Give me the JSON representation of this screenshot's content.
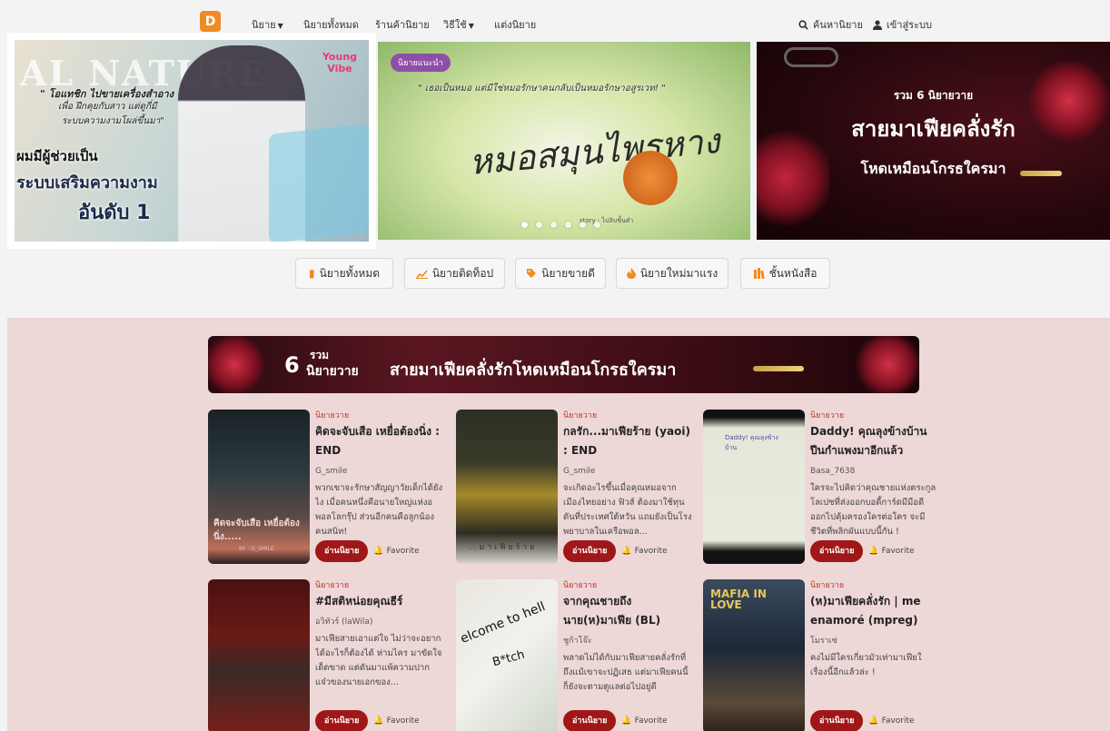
{
  "nav": {
    "logo": "D",
    "items": [
      {
        "label": "นิยาย",
        "dropdown": true
      },
      {
        "label": "นิยายทั้งหมด",
        "dropdown": false
      },
      {
        "label": "ร้านค้านิยาย",
        "dropdown": false
      },
      {
        "label": "วิธีใช้",
        "dropdown": true
      },
      {
        "label": "แต่งนิยาย",
        "dropdown": false
      }
    ],
    "search_label": "ค้นหานิยาย",
    "login_label": "เข้าสู่ระบบ"
  },
  "banners": {
    "b1": {
      "brand": "Young Vibe",
      "quote_line1": "\" โอแทชิก ไปขายเครื่องสำอาง",
      "quote_line2": "เพื่อ ฝึกคุยกับสาว แต่ดูกี่มี",
      "quote_line3": "ระบบความงามโผล่ขึ้นมา\"",
      "headline1": "ผมมีผู้ช่วยเป็น",
      "headline2": "ระบบเสริมความงาม",
      "headline3": "อันดับ 1",
      "bg_word": "AL NATURE"
    },
    "b2": {
      "tag": "นิยายแนะนำ",
      "quote": "\" เธอเป็นหมอ แต่มีใช่หมอรักษาคนกลับเป็นหมอรักษาอสูรเวท! \"",
      "calligraphy": "หมอสมุนไพรหาง",
      "credit": "story : ไปลิบชิ้นคำ",
      "dots": 6
    },
    "b3": {
      "line1": "รวม 6 นิยายวาย",
      "line2": "สายมาเฟียคลั่งรัก",
      "line3": "โหดเหมือนโกรธใครมา"
    }
  },
  "categories": [
    {
      "label": "นิยายทั้งหมด",
      "icon": "book-icon"
    },
    {
      "label": "นิยายติดท็อป",
      "icon": "chart-icon"
    },
    {
      "label": "นิยายขายดี",
      "icon": "tag-icon"
    },
    {
      "label": "นิยายใหม่มาแรง",
      "icon": "fire-icon"
    },
    {
      "label": "ชั้นหนังสือ",
      "icon": "bookshelf-icon"
    }
  ],
  "strip": {
    "num": "6",
    "small": "รวม",
    "sub": "นิยายวาย",
    "title": "สายมาเฟียคลั่งรักโหดเหมือนโกรธใครมา"
  },
  "books": [
    {
      "genre": "นิยายวาย",
      "title": "คิดจะจับเสือ เหยื่อต้องนิ่ง : END",
      "author": "G_smile",
      "desc": "พวกเขาจะรักษาสัญญาวัยเด็กได้ยังไง เมื่อคนหนึ่งคือนายใหญ่แห่งอพอลโลกรุ๊ป ส่วนอีกคนคือลูกน้องคนสนิท!",
      "read": "อ่านนิยาย",
      "fav": "Favorite",
      "cover_text": "คิดจะจับเสือ เหยื่อต้องนิ่ง.....",
      "cover_sub": "BY : G_SMILE"
    },
    {
      "genre": "นิยายวาย",
      "title": "กลรัก...มาเฟียร้าย (yaoi) : END",
      "author": "G_smile",
      "desc": "จะเกิดอะไรขึ้นเมื่อคุณหมอจากเมืองไทยอย่าง ฟิวส์ ต้องมาใช้ทุนดันที่ประเทศใต้หวัน แถมยังเป็นโรงพยาบาลในเครือพอล...",
      "read": "อ่านนิยาย",
      "fav": "Favorite",
      "cover_text": "ก ล รั ก . . .",
      "cover_sub": ". . ม า เ ฟี ย ร้ า ย"
    },
    {
      "genre": "นิยายวาย",
      "title": "Daddy! คุณลุงข้างบ้านปีนกำแพงมาอีกแล้ว",
      "author": "Basa_7638",
      "desc": "ใครจะไปคิดว่าคุณชายแห่งตระกูลโลเปซที่ส่งออกบอดี้การ์ดมีมือดีออกไปคุ้มครองใครต่อใคร จะมีชีวิตที่พลิกผันแบบนี้กัน !",
      "read": "อ่านนิยาย",
      "fav": "Favorite",
      "cover_text": "Daddy! คุณลุงข้างบ้าน",
      "cover_sub": ""
    },
    {
      "genre": "นิยายวาย",
      "title": "#มีสติหน่อยคุณธีร์",
      "author": "อวิทัวร์ (laWila)",
      "desc": "มาเฟียสายเอาแต่ใจ ไม่ว่าจะอยากได้อะไรก็ต้องได้ ห่ามไคร มาขัดใจเด็ดขาด แต่ดันมาแพ้ความปากแจ๋วของนายเอกของ...",
      "read": "อ่านนิยาย",
      "fav": "Favorite",
      "cover_text": "",
      "cover_sub": ""
    },
    {
      "genre": "นิยายวาย",
      "title": "จากคุณชายถึงนาย(ห)มาเฟีย (BL)",
      "author": "ชูก้าโจ๊ะ",
      "desc": "พลาดไม่ได้กับมาเฟียสายคลั่งรักที่ถึงแม้เขาจะปฏิเสธ แต่มาเฟียคนนี้ก็ยังจะตามตูแลต่อไปอยู่ดี",
      "read": "อ่านนิยาย",
      "fav": "Favorite",
      "cover_text": "elcome to hell",
      "cover_sub": "B*tch"
    },
    {
      "genre": "นิยายวาย",
      "title": "(ห)มาเฟียคลั่งรัก | me enamoré (mpreg)",
      "author": "โมราเซ่",
      "desc": "คงไม่มีใครเกี่ยวมัวเท่ามาเฟียใ เรื่องนี้อีกแล้วล่ะ !",
      "read": "อ่านนิยาย",
      "fav": "Favorite",
      "cover_text": "MAFIA IN LOVE",
      "cover_sub": ""
    }
  ]
}
